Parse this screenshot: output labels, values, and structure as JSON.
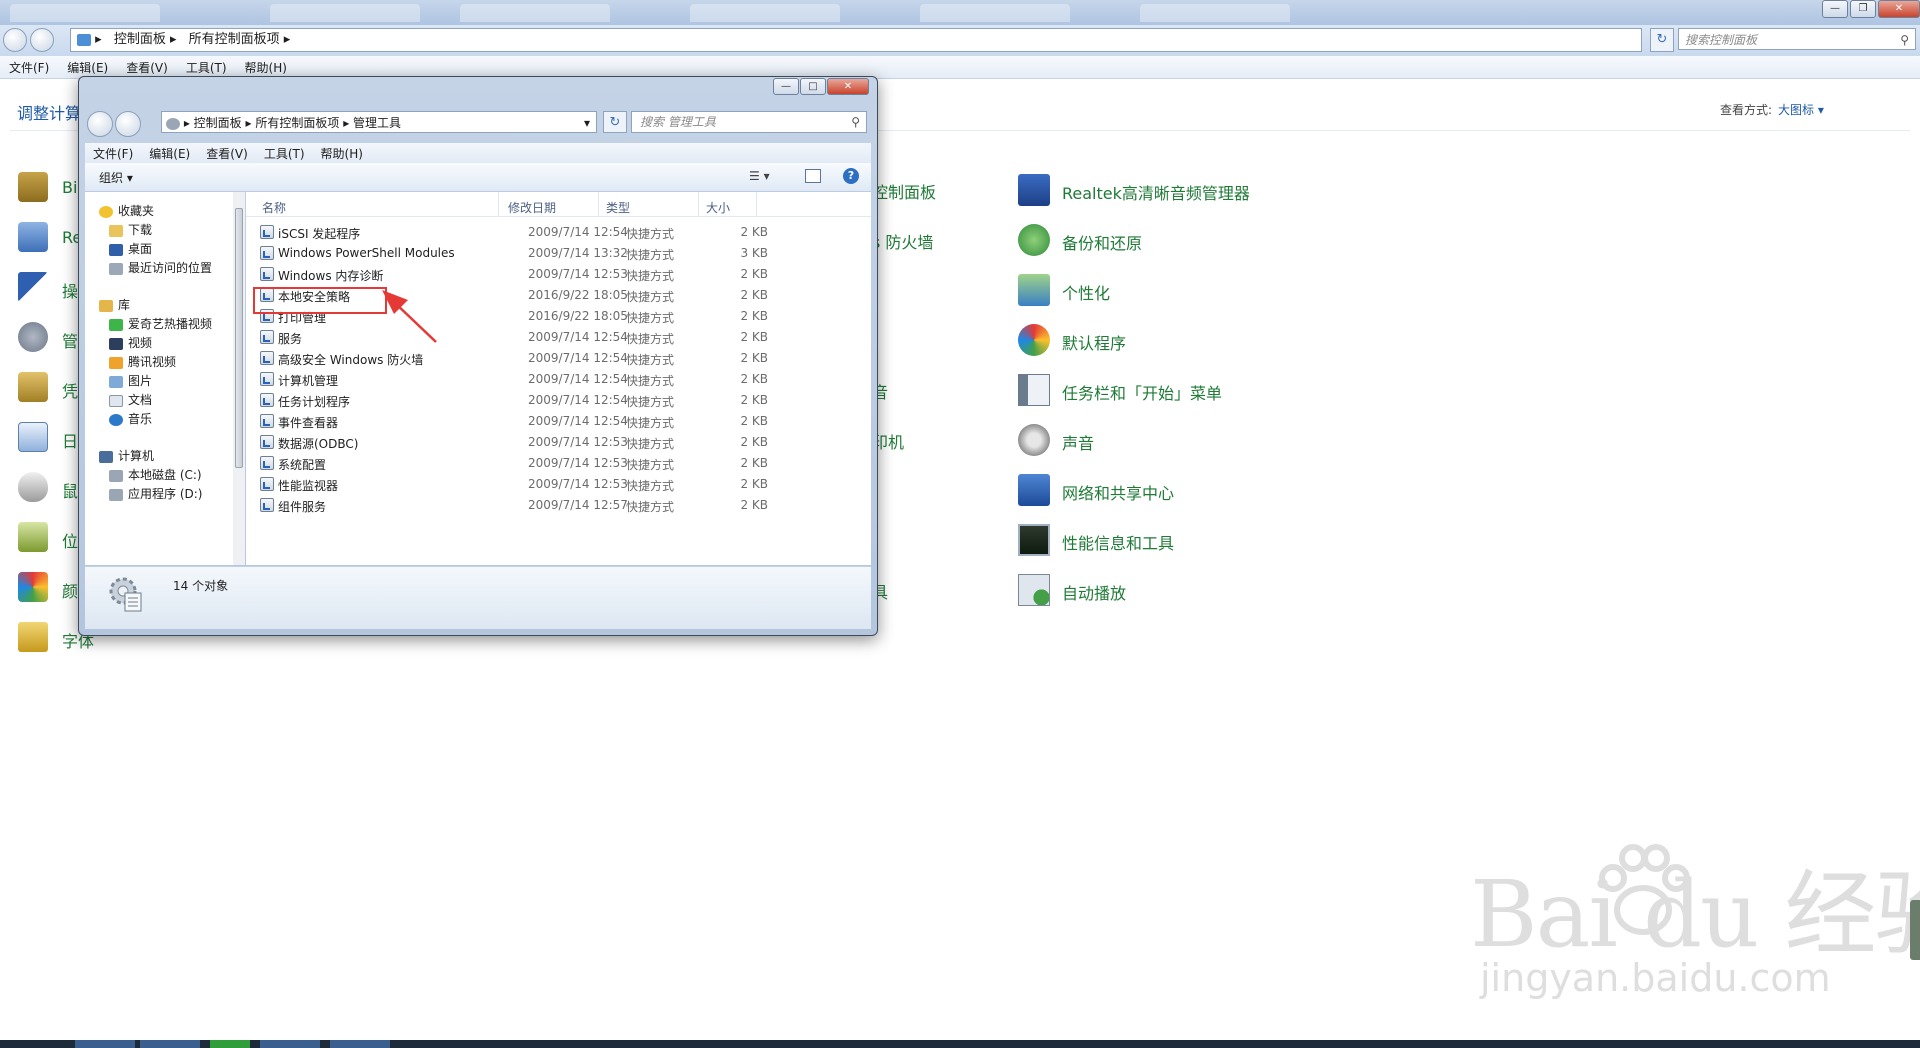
{
  "background_window": {
    "address_crumbs": [
      "控制面板",
      "所有控制面板项"
    ],
    "search_placeholder": "搜索控制面板",
    "menu": [
      "文件(F)",
      "编辑(E)",
      "查看(V)",
      "工具(T)",
      "帮助(H)"
    ],
    "heading": "调整计算",
    "view_by_label": "查看方式:",
    "view_by_value": "大图标 ▾",
    "left_column_items": [
      "Bi",
      "Re",
      "操",
      "管",
      "凭",
      "日",
      "鼠",
      "位",
      "颜",
      "字体"
    ],
    "middle_column_items": [
      "控制面板",
      "s 防火墙",
      "音",
      "印机",
      "具"
    ],
    "right_column_items": [
      "Realtek高清晰音频管理器",
      "备份和还原",
      "个性化",
      "默认程序",
      "任务栏和「开始」菜单",
      "声音",
      "网络和共享中心",
      "性能信息和工具",
      "自动播放"
    ]
  },
  "window": {
    "address_crumbs": [
      "控制面板",
      "所有控制面板项",
      "管理工具"
    ],
    "search_placeholder": "搜索 管理工具",
    "menu": [
      "文件(F)",
      "编辑(E)",
      "查看(V)",
      "工具(T)",
      "帮助(H)"
    ],
    "toolbar": {
      "organize": "组织 ▾",
      "help": "?"
    },
    "nav_pane": {
      "favorites": [
        "收藏夹",
        "下载",
        "桌面",
        "最近访问的位置"
      ],
      "libraries": [
        "库",
        "爱奇艺热播视频",
        "视频",
        "腾讯视频",
        "图片",
        "文档",
        "音乐"
      ],
      "computer": [
        "计算机",
        "本地磁盘 (C:)",
        "应用程序 (D:)"
      ]
    },
    "columns": [
      "名称",
      "修改日期",
      "类型",
      "大小"
    ],
    "files": [
      {
        "name": "iSCSI 发起程序",
        "date": "2009/7/14 12:54",
        "type": "快捷方式",
        "size": "2 KB"
      },
      {
        "name": "Windows PowerShell Modules",
        "date": "2009/7/14 13:32",
        "type": "快捷方式",
        "size": "3 KB"
      },
      {
        "name": "Windows 内存诊断",
        "date": "2009/7/14 12:53",
        "type": "快捷方式",
        "size": "2 KB"
      },
      {
        "name": "本地安全策略",
        "date": "2016/9/22 18:05",
        "type": "快捷方式",
        "size": "2 KB"
      },
      {
        "name": "打印管理",
        "date": "2016/9/22 18:05",
        "type": "快捷方式",
        "size": "2 KB"
      },
      {
        "name": "服务",
        "date": "2009/7/14 12:54",
        "type": "快捷方式",
        "size": "2 KB"
      },
      {
        "name": "高级安全 Windows 防火墙",
        "date": "2009/7/14 12:54",
        "type": "快捷方式",
        "size": "2 KB"
      },
      {
        "name": "计算机管理",
        "date": "2009/7/14 12:54",
        "type": "快捷方式",
        "size": "2 KB"
      },
      {
        "name": "任务计划程序",
        "date": "2009/7/14 12:54",
        "type": "快捷方式",
        "size": "2 KB"
      },
      {
        "name": "事件查看器",
        "date": "2009/7/14 12:54",
        "type": "快捷方式",
        "size": "2 KB"
      },
      {
        "name": "数据源(ODBC)",
        "date": "2009/7/14 12:53",
        "type": "快捷方式",
        "size": "2 KB"
      },
      {
        "name": "系统配置",
        "date": "2009/7/14 12:53",
        "type": "快捷方式",
        "size": "2 KB"
      },
      {
        "name": "性能监视器",
        "date": "2009/7/14 12:53",
        "type": "快捷方式",
        "size": "2 KB"
      },
      {
        "name": "组件服务",
        "date": "2009/7/14 12:57",
        "type": "快捷方式",
        "size": "2 KB"
      }
    ],
    "status_text": "14 个对象"
  },
  "watermark": {
    "brand": "Bai du 经验",
    "url": "jingyan.baidu.com"
  },
  "colors": {
    "link_green": "#1f7a36",
    "link_blue": "#1e5aa8",
    "highlight_red": "#e53935"
  }
}
